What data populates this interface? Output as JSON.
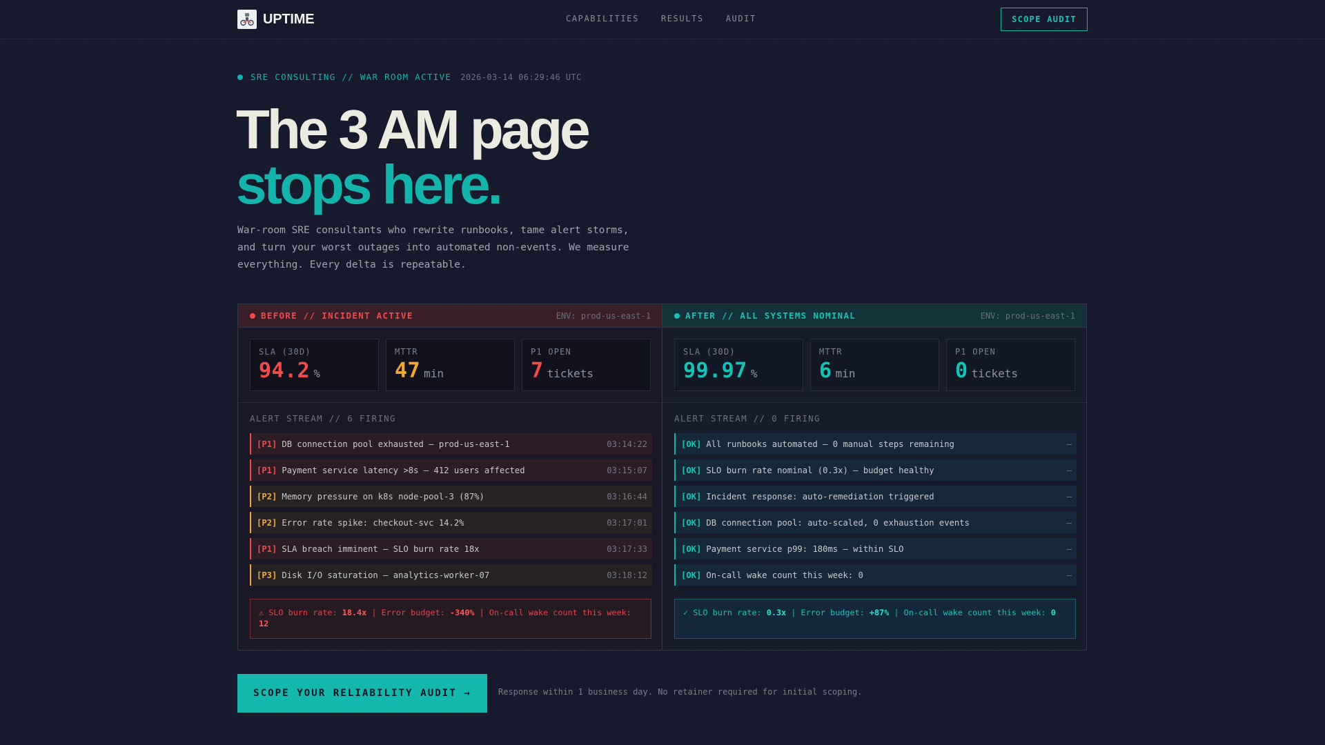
{
  "nav": {
    "brand": "UPTIME",
    "logo_icon": "robot-bike-icon",
    "links": [
      {
        "label": "CAPABILITIES"
      },
      {
        "label": "RESULTS"
      },
      {
        "label": "AUDIT"
      }
    ],
    "cta_label": "SCOPE AUDIT"
  },
  "hero": {
    "status_label": "SRE CONSULTING // WAR ROOM ACTIVE",
    "status_time": "2026-03-14 06:29:46 UTC",
    "headline_line1": "The 3 AM page",
    "headline_line2": "stops here.",
    "subcopy": "War-room SRE consultants who rewrite runbooks, tame alert storms, and turn your worst outages into automated non-events. We measure everything. Every delta is repeatable."
  },
  "before": {
    "title": "BEFORE // INCIDENT ACTIVE",
    "env": "ENV: prod-us-east-1",
    "metrics": [
      {
        "label": "SLA (30D)",
        "value": "94.2",
        "unit": "%"
      },
      {
        "label": "MTTR",
        "value": "47",
        "unit": "min"
      },
      {
        "label": "P1 OPEN",
        "value": "7",
        "unit": "tickets"
      }
    ],
    "stream_label": "ALERT STREAM // 6 FIRING",
    "alerts": [
      {
        "tag": "[P1]",
        "text": "DB connection pool exhausted — prod-us-east-1",
        "time": "03:14:22"
      },
      {
        "tag": "[P1]",
        "text": "Payment service latency >8s — 412 users affected",
        "time": "03:15:07"
      },
      {
        "tag": "[P2]",
        "text": "Memory pressure on k8s node-pool-3 (87%)",
        "time": "03:16:44"
      },
      {
        "tag": "[P2]",
        "text": "Error rate spike: checkout-svc 14.2%",
        "time": "03:17:01"
      },
      {
        "tag": "[P1]",
        "text": "SLA breach imminent — SLO burn rate 18x",
        "time": "03:17:33"
      },
      {
        "tag": "[P3]",
        "text": "Disk I/O saturation — analytics-worker-07",
        "time": "03:18:12"
      }
    ],
    "summary": {
      "prefix": "⚠ SLO burn rate: ",
      "burn": "18.4x",
      "sep1": "  |  Error budget: ",
      "budget": "-340%",
      "sep2": "  |  On-call wake count this week: ",
      "wakes": "12"
    }
  },
  "after": {
    "title": "AFTER // ALL SYSTEMS NOMINAL",
    "env": "ENV: prod-us-east-1",
    "metrics": [
      {
        "label": "SLA (30D)",
        "value": "99.97",
        "unit": "%"
      },
      {
        "label": "MTTR",
        "value": "6",
        "unit": "min"
      },
      {
        "label": "P1 OPEN",
        "value": "0",
        "unit": "tickets"
      }
    ],
    "stream_label": "ALERT STREAM // 0 FIRING",
    "alerts": [
      {
        "tag": "[OK]",
        "text": "All runbooks automated — 0 manual steps remaining",
        "time": "—"
      },
      {
        "tag": "[OK]",
        "text": "SLO burn rate nominal (0.3x) — budget healthy",
        "time": "—"
      },
      {
        "tag": "[OK]",
        "text": "Incident response: auto-remediation triggered",
        "time": "—"
      },
      {
        "tag": "[OK]",
        "text": "DB connection pool: auto-scaled, 0 exhaustion events",
        "time": "—"
      },
      {
        "tag": "[OK]",
        "text": "Payment service p99: 180ms — within SLO",
        "time": "—"
      },
      {
        "tag": "[OK]",
        "text": "On-call wake count this week: 0",
        "time": "—"
      }
    ],
    "summary": {
      "prefix": "✓ SLO burn rate: ",
      "burn": "0.3x",
      "sep1": "  |  Error budget: ",
      "budget": "+87%",
      "sep2": "  |  On-call wake count this week: ",
      "wakes": "0"
    }
  },
  "cta": {
    "button_label": "SCOPE YOUR RELIABILITY AUDIT →",
    "note": "Response within 1 business day. No retainer required for initial scoping."
  },
  "colors": {
    "background": "#171a2c",
    "accent": "#14b4aa",
    "danger": "#f04b48",
    "warning": "#f2a736"
  }
}
